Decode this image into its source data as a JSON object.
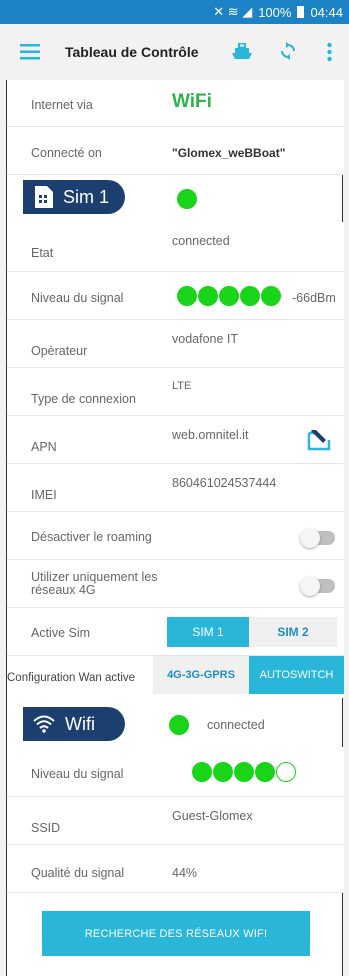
{
  "status_bar": {
    "signal_text": "✕ ≋ ◢",
    "battery": "100%",
    "time": "04:44"
  },
  "app_bar": {
    "title": "Tableau de Contrôle"
  },
  "internet": {
    "label": "Internet via",
    "value": "WiFi"
  },
  "connected_on": {
    "label": "Connecté on",
    "value": "\"Glomex_weBBoat\""
  },
  "sim": {
    "header": "Sim 1",
    "state": {
      "label": "Etat",
      "value": "connected"
    },
    "signal": {
      "label": "Niveau du signal",
      "value": "-66dBm",
      "bars_filled": 5,
      "bars_total": 5
    },
    "operator": {
      "label": "Opèrateur",
      "value": "vodafone IT"
    },
    "connection_type": {
      "label": "Type de connexion",
      "value": "LTE"
    },
    "apn": {
      "label": "APN",
      "value": "web.omnitel.it"
    },
    "imei": {
      "label": "IMEI",
      "value": "860461024537444"
    },
    "roaming": {
      "label": "Désactiver le roaming",
      "on": false
    },
    "only_4g": {
      "label_line1": "Utilizer uniquement les",
      "label_line2": "réseaux 4G",
      "on": false
    },
    "active_sim": {
      "label": "Active Sim",
      "options": [
        "SIM 1",
        "SIM 2"
      ],
      "selected": "SIM 1"
    }
  },
  "wan": {
    "label": "Configuration Wan active",
    "options": [
      "4G-3G-GPRS",
      "AUTOSWITCH"
    ],
    "selected": "AUTOSWITCH"
  },
  "wifi": {
    "header": "Wifi",
    "status": "connected",
    "signal": {
      "label": "Niveau du signal",
      "bars_filled": 4,
      "bars_total": 5
    },
    "ssid": {
      "label": "SSID",
      "value": "Guest-Glomex"
    },
    "quality": {
      "label": "Qualité du signal",
      "value": "44%"
    }
  },
  "scan_button": "RECHERCHE DES RÉSEAUX WIFI",
  "colors": {
    "accent": "#29b6d8",
    "navy": "#1d3f70",
    "green": "#19d419",
    "wifi_text": "#2db34a"
  }
}
